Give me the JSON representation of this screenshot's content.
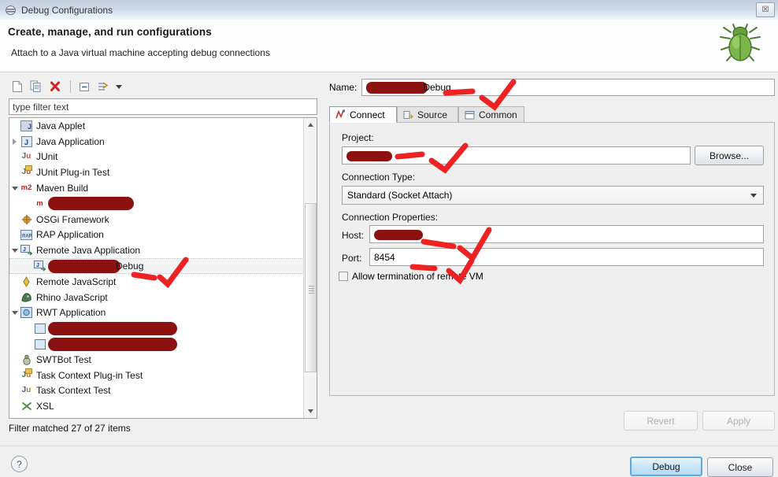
{
  "window": {
    "title": "Debug Configurations",
    "icon": "debug-configurations-icon",
    "close_label": "☒"
  },
  "header": {
    "title": "Create, manage, and run configurations",
    "subtitle": "Attach to a Java virtual machine accepting debug connections",
    "decor_icon": "green-bug-icon"
  },
  "toolbar": {
    "buttons": [
      {
        "name": "new-launch-configuration",
        "icon": "new-document-icon"
      },
      {
        "name": "duplicate-configuration",
        "icon": "copy-icon"
      },
      {
        "name": "delete-configuration",
        "icon": "red-x-icon"
      },
      {
        "name": "collapse-all",
        "icon": "collapse-all-icon"
      },
      {
        "name": "filter-configurations",
        "icon": "filter-icon"
      }
    ]
  },
  "filter": {
    "placeholder": "type filter text",
    "value": "",
    "matched_text": "Filter matched 27 of 27 items"
  },
  "tree": {
    "items": [
      {
        "label": "Java Applet",
        "icon": "java-applet-icon",
        "indent": 1,
        "twisty": "none",
        "selected": false,
        "redacted": false
      },
      {
        "label": "Java Application",
        "icon": "java-application-icon",
        "indent": 1,
        "twisty": "collapsed",
        "selected": false,
        "redacted": false
      },
      {
        "label": "JUnit",
        "icon": "junit-icon",
        "indent": 1,
        "twisty": "none",
        "selected": false,
        "redacted": false
      },
      {
        "label": "JUnit Plug-in Test",
        "icon": "junit-plugin-icon",
        "indent": 1,
        "twisty": "none",
        "selected": false,
        "redacted": false
      },
      {
        "label": "Maven Build",
        "icon": "maven-icon",
        "indent": 1,
        "twisty": "expanded",
        "selected": false,
        "redacted": false
      },
      {
        "label": "",
        "icon": "maven-child-icon",
        "indent": 2,
        "twisty": "none",
        "selected": false,
        "redacted": true,
        "redact_width": 105
      },
      {
        "label": "OSGi Framework",
        "icon": "osgi-icon",
        "indent": 1,
        "twisty": "none",
        "selected": false,
        "redacted": false
      },
      {
        "label": "RAP Application",
        "icon": "rap-icon",
        "indent": 1,
        "twisty": "none",
        "selected": false,
        "redacted": false
      },
      {
        "label": "Remote Java Application",
        "icon": "remote-java-application-icon",
        "indent": 1,
        "twisty": "expanded",
        "selected": false,
        "redacted": false
      },
      {
        "label": "Debug",
        "icon": "remote-java-config-icon",
        "indent": 2,
        "twisty": "none",
        "selected": true,
        "redacted": true,
        "redact_width": 88
      },
      {
        "label": "Remote JavaScript",
        "icon": "remote-javascript-icon",
        "indent": 1,
        "twisty": "none",
        "selected": false,
        "redacted": false
      },
      {
        "label": "Rhino JavaScript",
        "icon": "rhino-javascript-icon",
        "indent": 1,
        "twisty": "none",
        "selected": false,
        "redacted": false
      },
      {
        "label": "RWT Application",
        "icon": "rwt-icon",
        "indent": 1,
        "twisty": "expanded",
        "selected": false,
        "redacted": false
      },
      {
        "label": "",
        "icon": "rwt-child-icon",
        "indent": 2,
        "twisty": "none",
        "selected": false,
        "redacted": true,
        "redact_width": 160
      },
      {
        "label": "",
        "icon": "rwt-child-icon",
        "indent": 2,
        "twisty": "none",
        "selected": false,
        "redacted": true,
        "redact_width": 160
      },
      {
        "label": "SWTBot Test",
        "icon": "swtbot-icon",
        "indent": 1,
        "twisty": "none",
        "selected": false,
        "redacted": false
      },
      {
        "label": "Task Context Plug-in Test",
        "icon": "task-context-plugin-icon",
        "indent": 1,
        "twisty": "none",
        "selected": false,
        "redacted": false
      },
      {
        "label": "Task Context Test",
        "icon": "task-context-icon",
        "indent": 1,
        "twisty": "none",
        "selected": false,
        "redacted": false
      },
      {
        "label": "XSL",
        "icon": "xsl-icon",
        "indent": 1,
        "twisty": "none",
        "selected": false,
        "redacted": false
      }
    ]
  },
  "config": {
    "name_label": "Name:",
    "name_value": "Debug",
    "tabs": [
      {
        "label": "Connect",
        "icon": "connect-icon",
        "active": true
      },
      {
        "label": "Source",
        "icon": "source-icon",
        "active": false
      },
      {
        "label": "Common",
        "icon": "common-icon",
        "active": false
      }
    ],
    "project_label": "Project:",
    "project_value": "",
    "browse_label": "Browse...",
    "connection_type_label": "Connection Type:",
    "connection_type_value": "Standard (Socket Attach)",
    "connection_properties_label": "Connection Properties:",
    "host_label": "Host:",
    "host_value": "",
    "port_label": "Port:",
    "port_value": "8454",
    "allow_termination_label": "Allow termination of remote VM",
    "allow_termination_checked": false
  },
  "buttons": {
    "revert": "Revert",
    "apply": "Apply",
    "debug": "Debug",
    "close": "Close",
    "help": "?"
  },
  "colors": {
    "redaction": "#8c1111",
    "annotation": "#ee2222",
    "accent": "#5ea7e0",
    "titlebar_top": "#c5d0de",
    "titlebar_bottom": "#f2f7fc"
  }
}
